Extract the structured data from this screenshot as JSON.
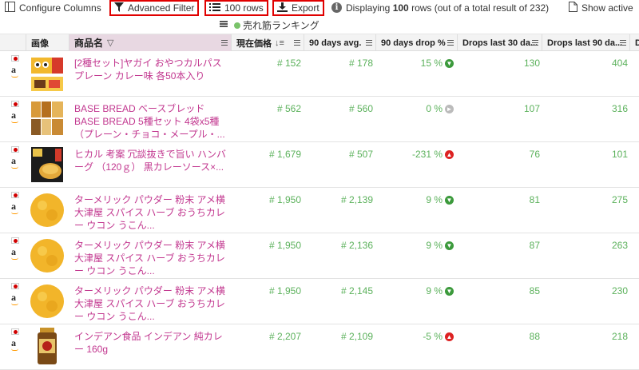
{
  "toolbar": {
    "configure_columns": "Configure Columns",
    "advanced_filter": "Advanced Filter",
    "rows": "100 rows",
    "export": "Export",
    "displaying_prefix": "Displaying",
    "displaying_count": "100",
    "displaying_suffix": "rows (out of a total result of 232)",
    "show_active": "Show active"
  },
  "group": {
    "label": "売れ筋ランキング"
  },
  "columns": {
    "image": "画像",
    "product_name": "商品名",
    "current_price": "現在価格",
    "avg90": "90 days avg.",
    "drop90": "90 days drop %",
    "drops30": "Drops last 30 da...",
    "drops90": "Drops last 90 da...",
    "extra": "D"
  },
  "rows": [
    {
      "name": "[2種セット]ヤガイ おやつカルパス プレーン カレー味 各50本入り",
      "price": "# 152",
      "avg": "# 178",
      "drop": "15 %",
      "dir": "down",
      "d30": "130",
      "d90": "404"
    },
    {
      "name": "BASE BREAD ベースブレッド BASE BREAD 5種セット 4袋x5種 （プレーン・チョコ・メープル・...",
      "price": "# 562",
      "avg": "# 560",
      "drop": "0 %",
      "dir": "flat",
      "d30": "107",
      "d90": "316"
    },
    {
      "name": "ヒカル 考案 冗談抜きで旨い ハンバーグ （120ｇ） 黒カレーソース×...",
      "price": "# 1,679",
      "avg": "# 507",
      "drop": "-231 %",
      "dir": "up",
      "d30": "76",
      "d90": "101"
    },
    {
      "name": "ターメリック パウダー 粉末 アメ横 大津屋 スパイス ハーブ おうちカレー ウコン うこん...",
      "price": "# 1,950",
      "avg": "# 2,139",
      "drop": "9 %",
      "dir": "down",
      "d30": "81",
      "d90": "275"
    },
    {
      "name": "ターメリック パウダー 粉末 アメ横 大津屋 スパイス ハーブ おうちカレー ウコン うこん...",
      "price": "# 1,950",
      "avg": "# 2,136",
      "drop": "9 %",
      "dir": "down",
      "d30": "87",
      "d90": "263"
    },
    {
      "name": "ターメリック パウダー 粉末 アメ横 大津屋 スパイス ハーブ おうちカレー ウコン うこん...",
      "price": "# 1,950",
      "avg": "# 2,145",
      "drop": "9 %",
      "dir": "down",
      "d30": "85",
      "d90": "230"
    },
    {
      "name": "インデアン食品 インデアン 純カレー 160g",
      "price": "# 2,207",
      "avg": "# 2,109",
      "drop": "-5 %",
      "dir": "up",
      "d30": "88",
      "d90": "218"
    }
  ]
}
